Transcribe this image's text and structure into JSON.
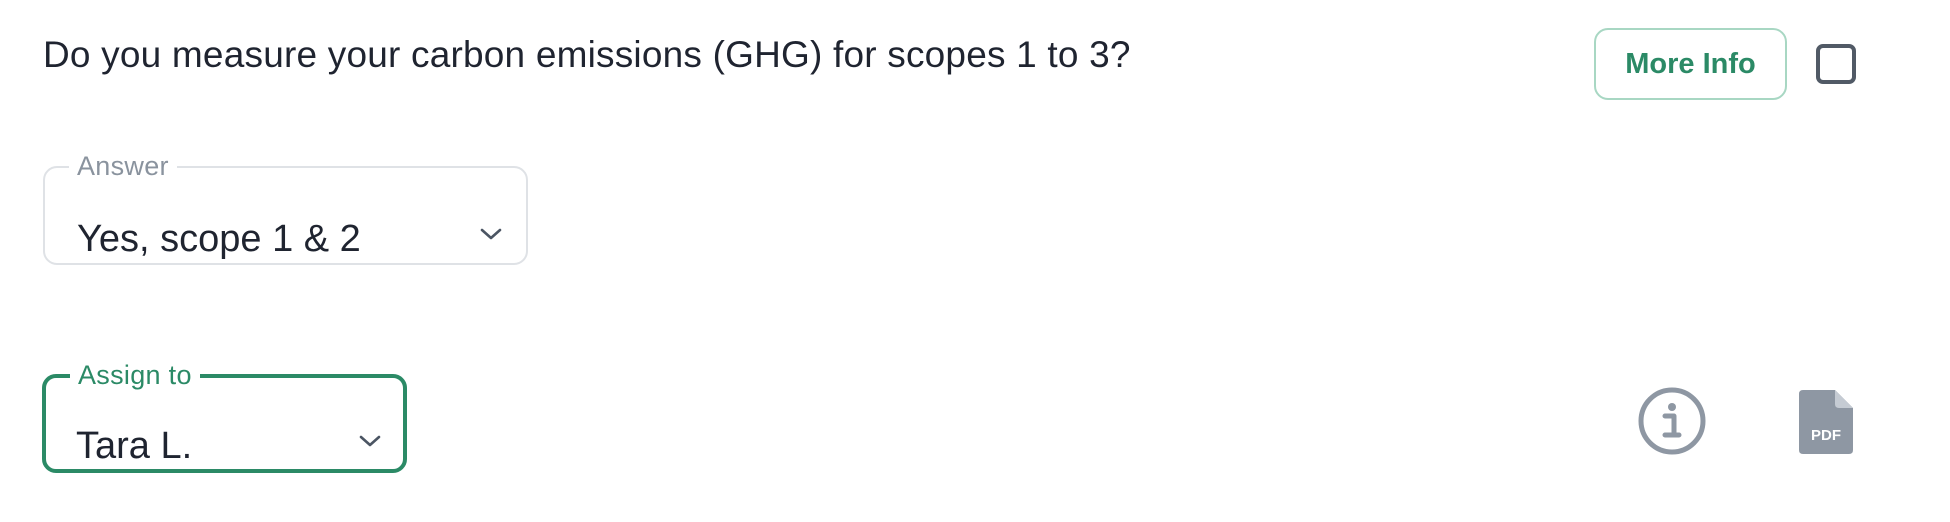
{
  "question": {
    "text": "Do you measure your carbon emissions (GHG) for scopes 1 to 3?"
  },
  "more_info_button": {
    "label": "More Info"
  },
  "answer": {
    "label": "Answer",
    "value": "Yes, scope 1 & 2"
  },
  "assign": {
    "label": "Assign to",
    "value": "Tara L."
  },
  "icons": {
    "chevron": "chevron-down-icon",
    "info": "info-icon",
    "pdf": "pdf-file-icon",
    "pdf_badge": "PDF"
  },
  "colors": {
    "accent": "#2b8a66",
    "accent_border": "#a8d7c3",
    "icon_gray": "#8e97a3",
    "text": "#1f2430",
    "muted": "#8a939e"
  }
}
